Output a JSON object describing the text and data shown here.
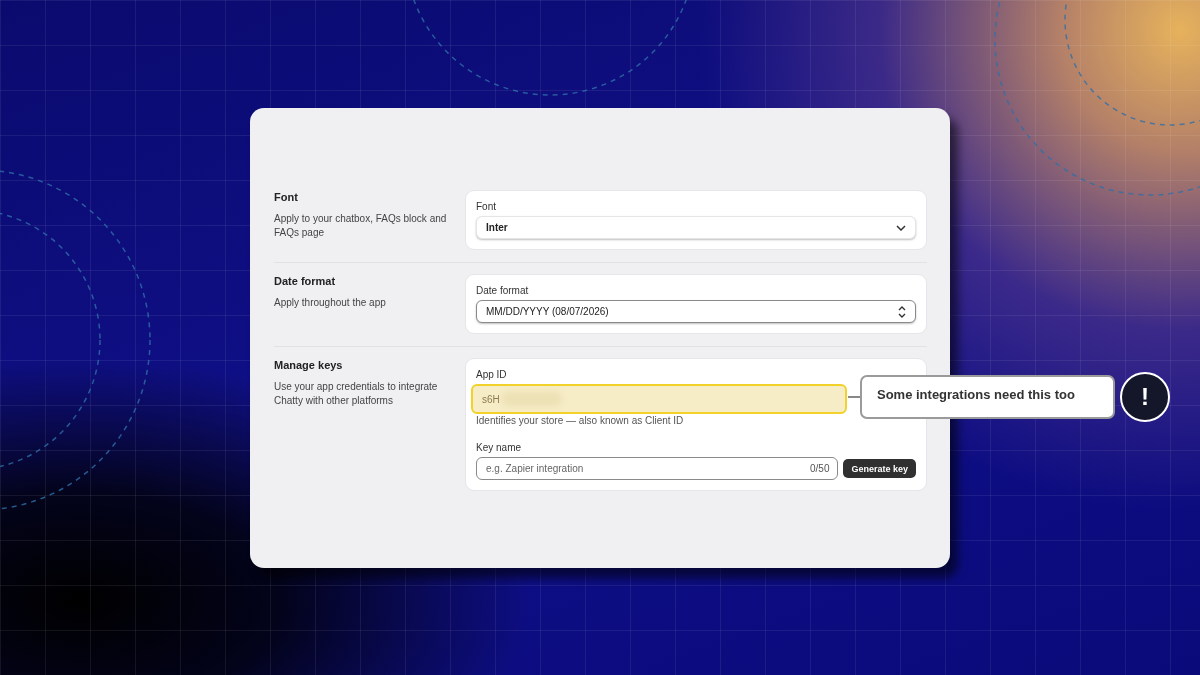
{
  "sections": [
    {
      "title": "Font",
      "description": "Apply to your chatbox, FAQs block and FAQs page",
      "fields": [
        {
          "kind": "select",
          "label": "Font",
          "value": "Inter"
        }
      ]
    },
    {
      "title": "Date format",
      "description": "Apply throughout the app",
      "fields": [
        {
          "kind": "spinner",
          "label": "Date format",
          "value": "MM/DD/YYYY (08/07/2026)"
        }
      ]
    },
    {
      "title": "Manage keys",
      "description": "Use your app credentials to integrate Chatty with other platforms",
      "fields": [
        {
          "kind": "secret",
          "label": "App ID",
          "value": "s6H",
          "highlighted": true,
          "help": "Identifies your store — also known as Client ID"
        },
        {
          "kind": "input",
          "label": "Key name",
          "placeholder": "e.g. Zapier integration",
          "counter": "0/50",
          "button": "Generate key"
        }
      ]
    }
  ],
  "callout": {
    "text": "Some integrations need this too",
    "badge": "!"
  }
}
